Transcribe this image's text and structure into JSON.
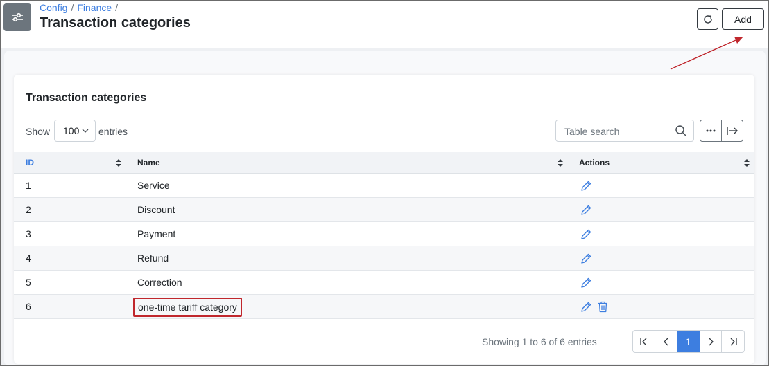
{
  "header": {
    "breadcrumb": [
      "Config",
      "Finance"
    ],
    "breadcrumb_separator": "/",
    "title": "Transaction categories",
    "refresh_icon": "refresh-icon",
    "add_label": "Add",
    "app_icon": "sliders-icon"
  },
  "card": {
    "title": "Transaction categories",
    "show_label": "Show",
    "entries_value": "100",
    "entries_label": "entries",
    "search_placeholder": "Table search"
  },
  "table": {
    "columns": [
      "ID",
      "Name",
      "Actions"
    ],
    "rows": [
      {
        "id": "1",
        "name": "Service"
      },
      {
        "id": "2",
        "name": "Discount"
      },
      {
        "id": "3",
        "name": "Payment"
      },
      {
        "id": "4",
        "name": "Refund"
      },
      {
        "id": "5",
        "name": "Correction"
      },
      {
        "id": "6",
        "name": "one-time tariff category"
      }
    ]
  },
  "footer": {
    "showing_text": "Showing 1 to 6 of 6 entries",
    "current_page": "1"
  },
  "colors": {
    "accent": "#3d7ee0",
    "annotation": "#c0272d",
    "app_icon_bg": "#6c757d"
  }
}
